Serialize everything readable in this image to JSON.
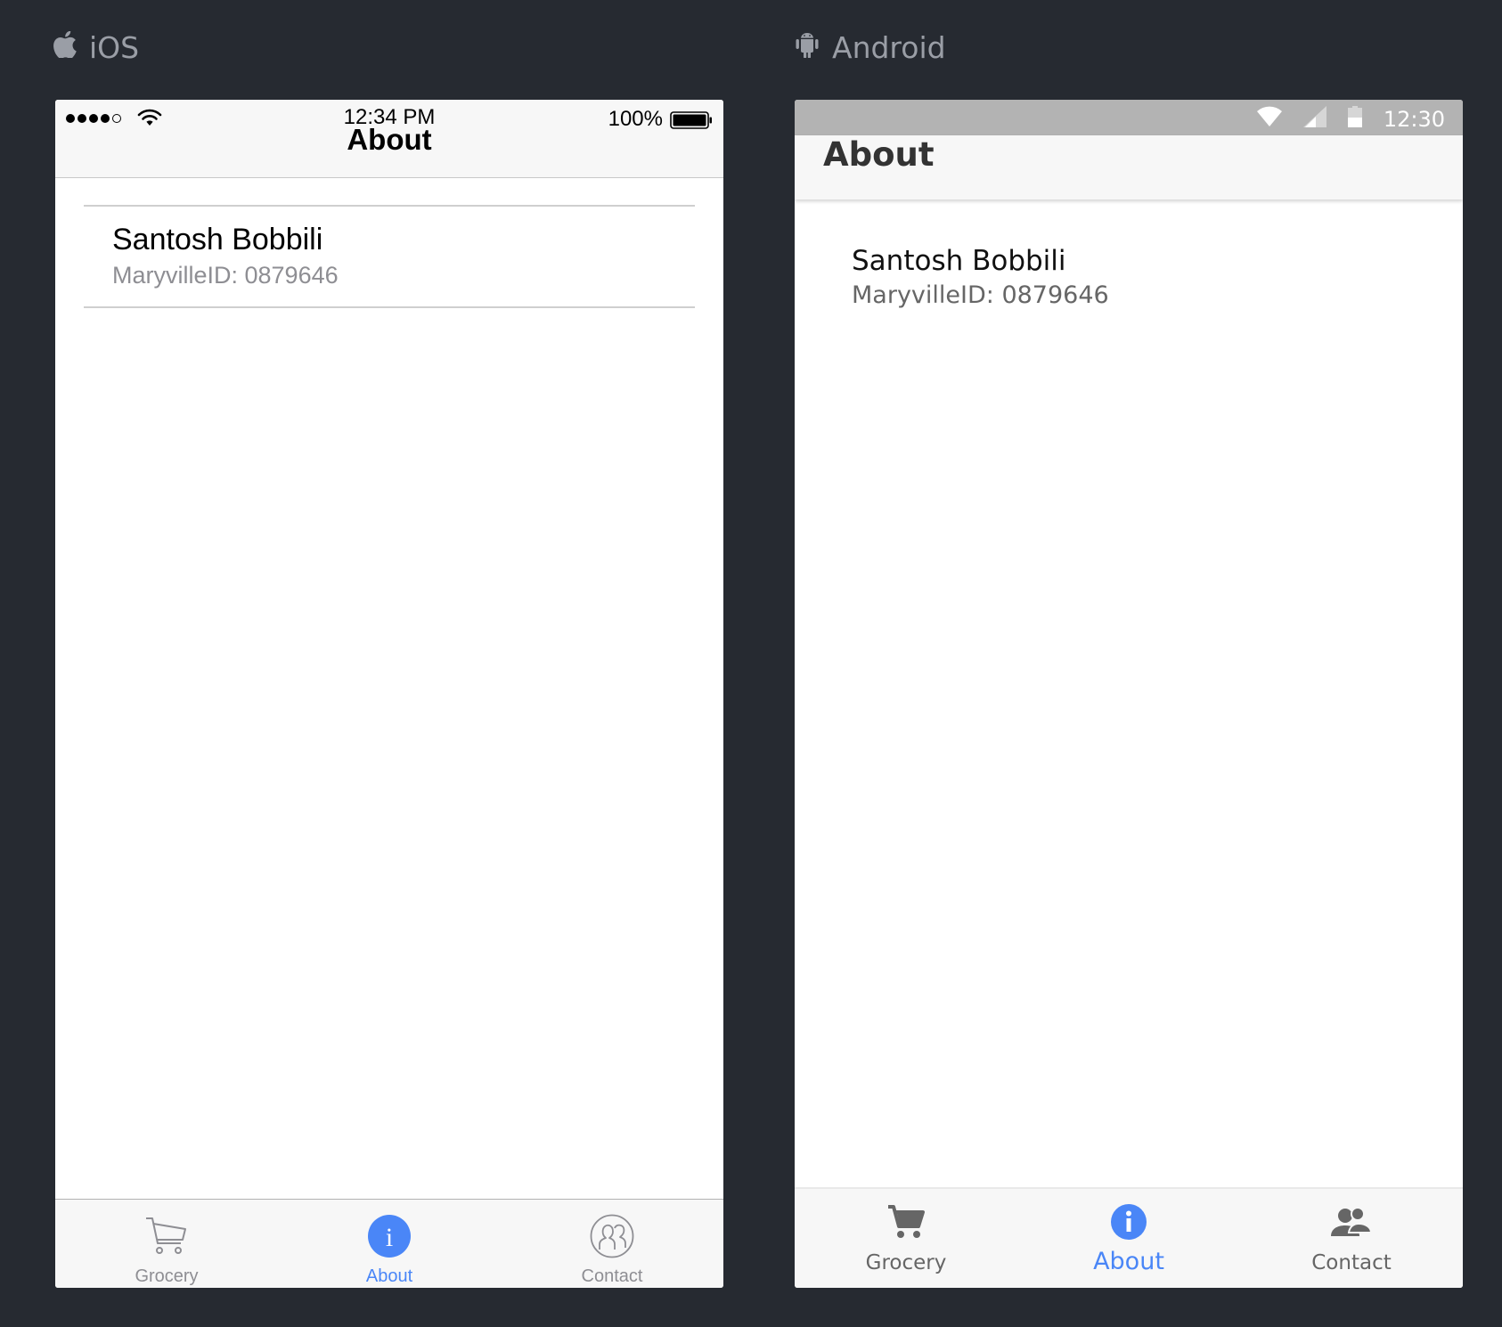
{
  "platforms": {
    "ios": {
      "label": "iOS",
      "icon": "apple-icon",
      "status_bar": {
        "time": "12:34 PM",
        "battery": "100%",
        "signal_dots": 5,
        "signal_filled": 4
      },
      "nav_title": "About",
      "list_item": {
        "name": "Santosh Bobbili",
        "detail": "MaryvilleID: 0879646"
      },
      "tabs": [
        {
          "label": "Grocery",
          "icon": "cart-icon",
          "active": false
        },
        {
          "label": "About",
          "icon": "info-icon",
          "active": true
        },
        {
          "label": "Contact",
          "icon": "contacts-icon",
          "active": false
        }
      ]
    },
    "android": {
      "label": "Android",
      "icon": "android-icon",
      "status_bar": {
        "time": "12:30"
      },
      "app_bar_title": "About",
      "list_item": {
        "name": "Santosh Bobbili",
        "detail": "MaryvilleID: 0879646"
      },
      "tabs": [
        {
          "label": "Grocery",
          "icon": "cart-icon",
          "active": false
        },
        {
          "label": "About",
          "icon": "info-icon",
          "active": true
        },
        {
          "label": "Contact",
          "icon": "contacts-icon",
          "active": false
        }
      ]
    }
  },
  "colors": {
    "background": "#262a31",
    "accent": "#4a86f7",
    "inactive": "#8e8e93"
  }
}
